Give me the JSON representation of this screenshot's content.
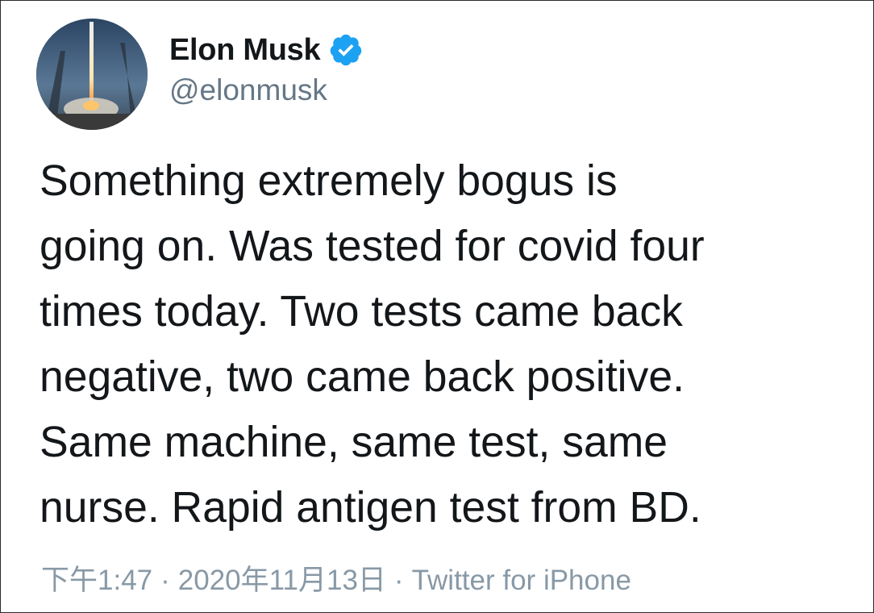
{
  "author": {
    "display_name": "Elon Musk",
    "handle": "@elonmusk",
    "avatar_icon": "rocket-launch-avatar",
    "verified_icon": "verified-badge-icon"
  },
  "tweet": {
    "lines": [
      "Something extremely bogus is",
      "going on. Was tested for covid four",
      "times today. Two tests came back",
      "negative, two came back positive.",
      "Same machine, same test, same",
      "nurse. Rapid antigen test from BD."
    ]
  },
  "meta": {
    "time": "下午1:47",
    "separator": "·",
    "date": "2020年11月13日",
    "source": "Twitter for iPhone"
  },
  "colors": {
    "text": "#14171a",
    "secondary": "#657786",
    "meta": "#8899a6",
    "verified": "#1da1f2"
  }
}
